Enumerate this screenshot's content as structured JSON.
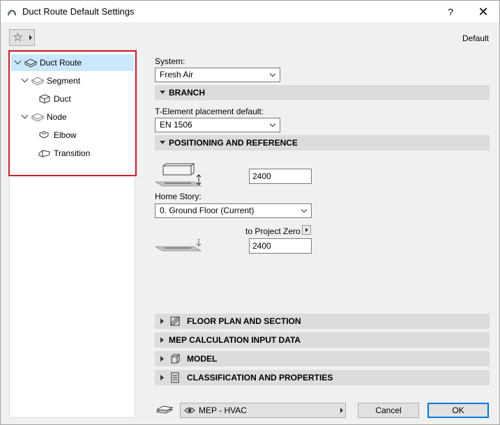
{
  "window": {
    "title": "Duct Route Default Settings",
    "help": "?",
    "close": "✕"
  },
  "toolbar": {
    "favorites_icon": "star-icon",
    "default_label": "Default"
  },
  "tree": {
    "items": [
      {
        "label": "Duct Route",
        "icon": "duct-route-icon",
        "expanded": true,
        "selected": true
      },
      {
        "label": "Segment",
        "icon": "segment-icon",
        "expanded": true
      },
      {
        "label": "Duct",
        "icon": "duct-icon"
      },
      {
        "label": "Node",
        "icon": "node-icon",
        "expanded": true
      },
      {
        "label": "Elbow",
        "icon": "elbow-icon"
      },
      {
        "label": "Transition",
        "icon": "transition-icon"
      }
    ]
  },
  "main": {
    "system": {
      "label": "System:",
      "value": "Fresh Air"
    },
    "branch": {
      "title": "BRANCH",
      "t_element_label": "T-Element placement default:",
      "t_element_value": "EN 1506"
    },
    "positioning": {
      "title": "POSITIONING AND REFERENCE",
      "height_value": "2400",
      "home_story_label": "Home Story:",
      "home_story_value": "0. Ground Floor (Current)",
      "reference_label": "to Project Zero",
      "reference_value": "2400"
    },
    "sections": [
      {
        "title": "FLOOR PLAN AND SECTION",
        "icon": "floor-plan-icon"
      },
      {
        "title": "MEP CALCULATION INPUT DATA"
      },
      {
        "title": "MODEL",
        "icon": "model-cube-icon"
      },
      {
        "title": "CLASSIFICATION AND PROPERTIES",
        "icon": "document-icon"
      }
    ]
  },
  "footer": {
    "layer_value": "MEP - HVAC",
    "cancel_label": "Cancel",
    "ok_label": "OK"
  }
}
